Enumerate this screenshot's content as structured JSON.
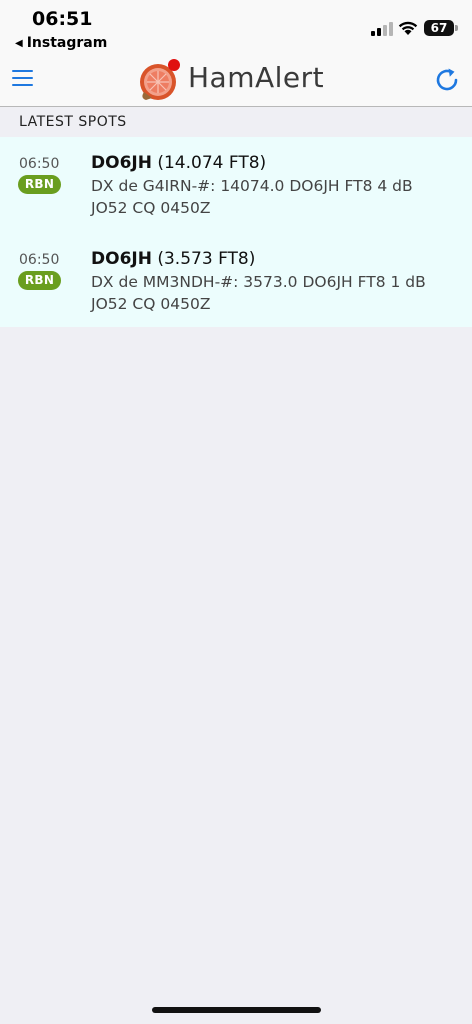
{
  "status_bar": {
    "time": "06:51",
    "back_app": "Instagram",
    "battery": "67"
  },
  "header": {
    "brand": "HamAlert"
  },
  "section": {
    "title": "LATEST SPOTS"
  },
  "spots": [
    {
      "time": "06:50",
      "source": "RBN",
      "callsign": "DO6JH",
      "freq_mode": "(14.074 FT8)",
      "line2": "DX de G4IRN-#: 14074.0 DO6JH FT8 4 dB",
      "line3": "JO52 CQ 0450Z"
    },
    {
      "time": "06:50",
      "source": "RBN",
      "callsign": "DO6JH",
      "freq_mode": "(3.573 FT8)",
      "line2": "DX de MM3NDH-#: 3573.0 DO6JH FT8 1 dB",
      "line3": "JO52 CQ 0450Z"
    }
  ],
  "colors": {
    "accent": "#1e78e0",
    "badge": "#6a9e1f",
    "spot_bg": "#ecfdfd",
    "page_bg": "#efeff4"
  }
}
